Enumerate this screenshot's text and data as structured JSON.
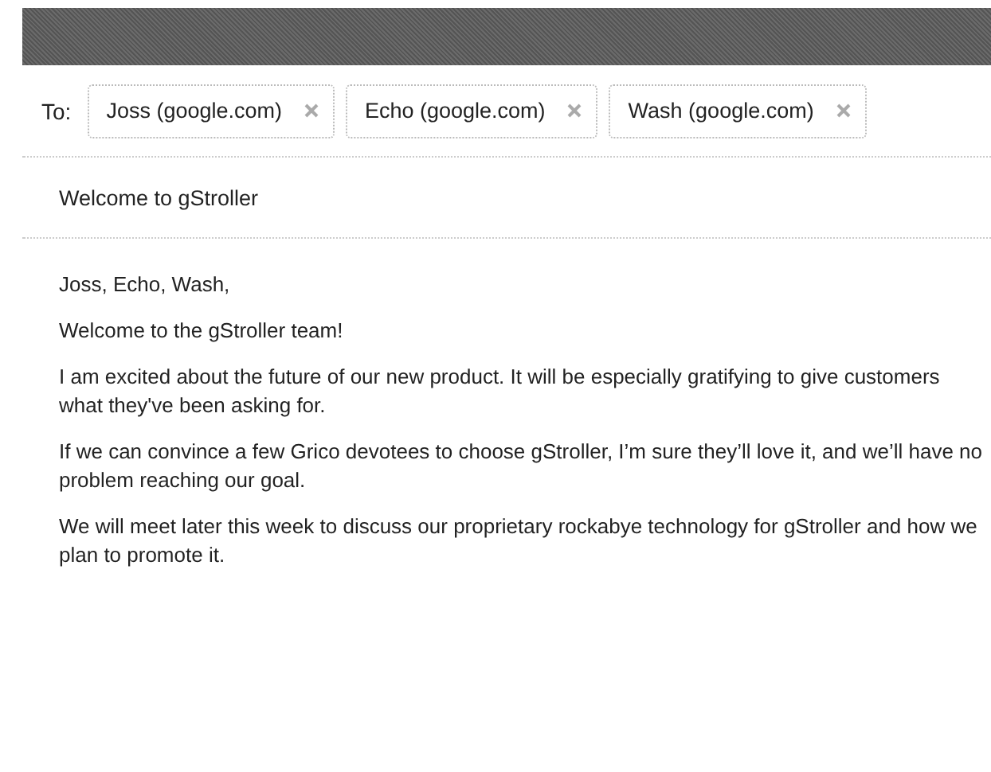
{
  "to_label": "To:",
  "recipients": [
    {
      "name": "Joss (google.com)"
    },
    {
      "name": "Echo (google.com)"
    },
    {
      "name": "Wash (google.com)"
    }
  ],
  "subject": "Welcome to gStroller",
  "body": [
    "Joss, Echo, Wash,",
    "Welcome to the gStroller team!",
    "I am excited about the future of our new product. It will be especially gratifying to give customers what they've been asking for.",
    "If we can convince a few Grico devotees to choose gStroller, I’m sure they’ll love it, and we’ll have no problem reaching our goal.",
    "We will meet later this week to discuss our proprietary rockabye technology for gStroller and how we plan to promote it."
  ]
}
